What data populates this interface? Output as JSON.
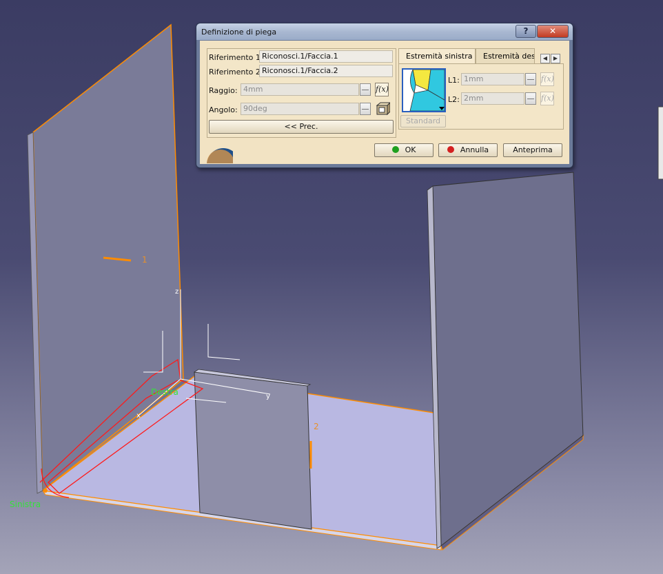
{
  "dialog": {
    "title": "Definizione di piega",
    "help_label": "?",
    "close_label": "✕",
    "references": [
      {
        "label": "Riferimento 1:",
        "value": "Riconosci.1/Faccia.1"
      },
      {
        "label": "Riferimento 2:",
        "value": "Riconosci.1/Faccia.2"
      }
    ],
    "radius": {
      "label": "Raggio:",
      "value": "4mm"
    },
    "angle": {
      "label": "Angolo:",
      "value": "90deg"
    },
    "prev_button": "<< Prec.",
    "fx_label": "f(x)",
    "tabs": [
      "Estremità sinistra",
      "Estremità destra"
    ],
    "l1": {
      "label": "L1:",
      "value": "1mm"
    },
    "l2": {
      "label": "L2:",
      "value": "2mm"
    },
    "standard_button": "Standard",
    "ok_button": "OK",
    "cancel_button": "Annulla",
    "preview_button": "Anteprima",
    "colors": {
      "ok_dot": "#1fa01f",
      "cancel_dot": "#d42020"
    }
  },
  "viewport": {
    "labels": {
      "face1": "1",
      "face2": "2",
      "right": "Destra",
      "left": "Sinistra",
      "axis_z": "z",
      "axis_y": "y",
      "axis_x": "x"
    },
    "colors": {
      "background_top": "#3b3c63",
      "highlight": "#ff8c00",
      "selection": "#ff1a1a",
      "label_green": "#35e23a"
    }
  }
}
